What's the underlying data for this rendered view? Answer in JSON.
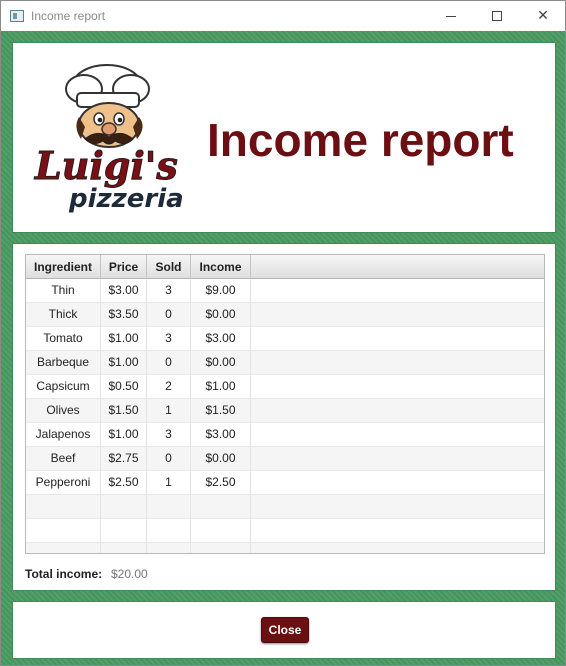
{
  "window": {
    "title": "Income report"
  },
  "header": {
    "title": "Income report",
    "logo_text_main": "Luigi's",
    "logo_text_sub": "pizzeria"
  },
  "table": {
    "columns": [
      "Ingredient",
      "Price",
      "Sold",
      "Income"
    ],
    "rows": [
      [
        "Thin",
        "$3.00",
        "3",
        "$9.00"
      ],
      [
        "Thick",
        "$3.50",
        "0",
        "$0.00"
      ],
      [
        "Tomato",
        "$1.00",
        "3",
        "$3.00"
      ],
      [
        "Barbeque",
        "$1.00",
        "0",
        "$0.00"
      ],
      [
        "Capsicum",
        "$0.50",
        "2",
        "$1.00"
      ],
      [
        "Olives",
        "$1.50",
        "1",
        "$1.50"
      ],
      [
        "Jalapenos",
        "$1.00",
        "3",
        "$3.00"
      ],
      [
        "Beef",
        "$2.75",
        "0",
        "$0.00"
      ],
      [
        "Pepperoni",
        "$2.50",
        "1",
        "$2.50"
      ]
    ]
  },
  "summary": {
    "total_label": "Total income:",
    "total_value": "$20.00"
  },
  "footer": {
    "close_label": "Close"
  },
  "colors": {
    "brand": "#6b0f12",
    "background": "#4a9a61"
  },
  "icons": {
    "app": "window-app-icon",
    "minimize": "minimize-icon",
    "maximize": "maximize-icon",
    "close": "close-icon"
  }
}
